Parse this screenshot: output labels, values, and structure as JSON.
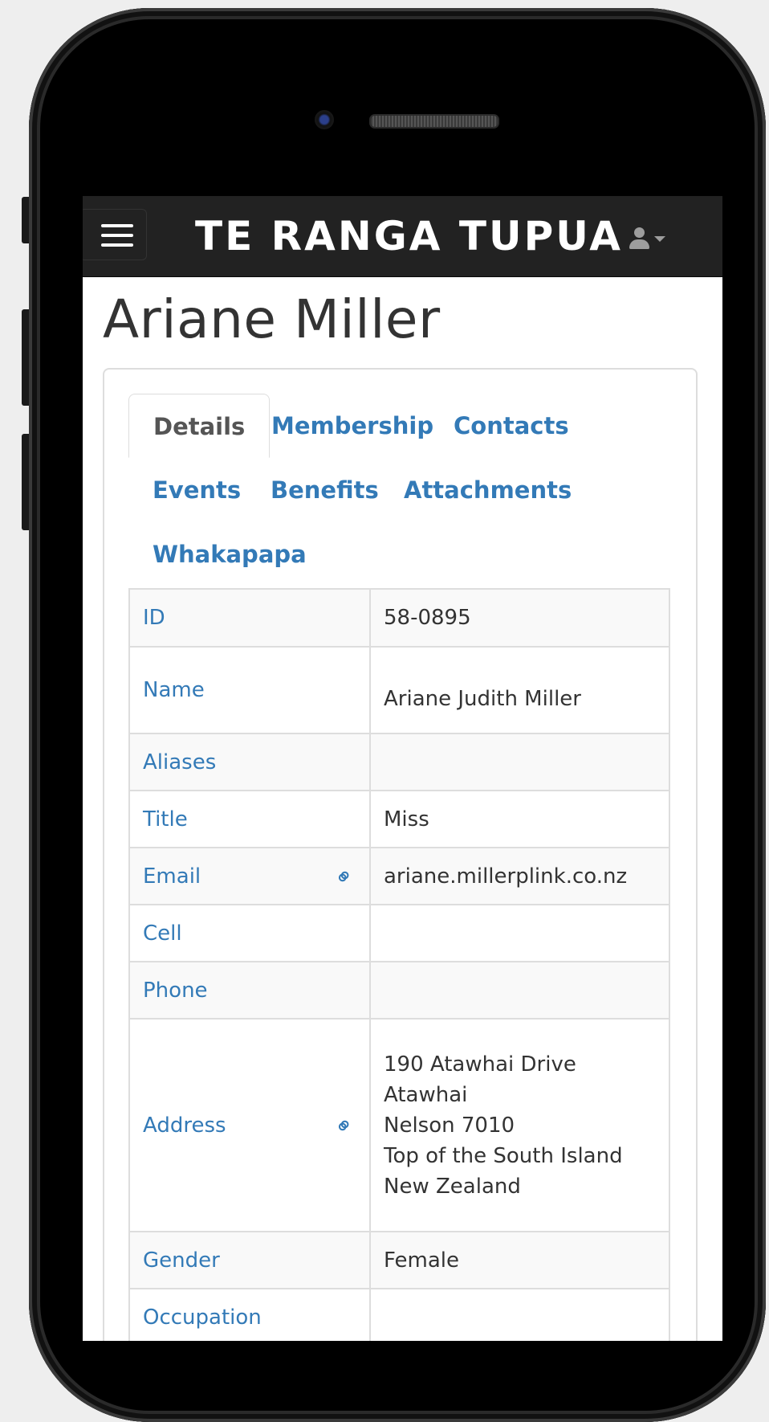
{
  "navbar": {
    "brand": "TE RANGA TUPUA",
    "menu_icon": "hamburger-icon",
    "user_icon": "user-icon"
  },
  "page": {
    "title": "Ariane Miller"
  },
  "tabs": [
    {
      "label": "Details",
      "active": true
    },
    {
      "label": "Membership",
      "active": false
    },
    {
      "label": "Contacts",
      "active": false
    },
    {
      "label": "Events",
      "active": false
    },
    {
      "label": "Benefits",
      "active": false
    },
    {
      "label": "Attachments",
      "active": false
    },
    {
      "label": "Whakapapa",
      "active": false
    }
  ],
  "details": {
    "id": {
      "label": "ID",
      "value": "58-0895"
    },
    "name": {
      "label": "Name",
      "value": "Ariane Judith Miller"
    },
    "aliases": {
      "label": "Aliases",
      "value": ""
    },
    "title": {
      "label": "Title",
      "value": "Miss"
    },
    "email": {
      "label": "Email",
      "value": "ariane.millerplink.co.nz",
      "icon": "link-icon"
    },
    "cell": {
      "label": "Cell",
      "value": ""
    },
    "phone": {
      "label": "Phone",
      "value": ""
    },
    "address": {
      "label": "Address",
      "icon": "link-icon",
      "lines": [
        "190 Atawhai Drive",
        "Atawhai",
        "Nelson 7010",
        "Top of the South Island",
        "New Zealand"
      ]
    },
    "gender": {
      "label": "Gender",
      "value": "Female"
    },
    "occupation": {
      "label": "Occupation",
      "value": ""
    }
  },
  "colors": {
    "navbar_bg": "#222222",
    "link": "#337ab7",
    "text": "#333333",
    "table_stripe": "#f9f9f9",
    "border": "#dddddd"
  }
}
